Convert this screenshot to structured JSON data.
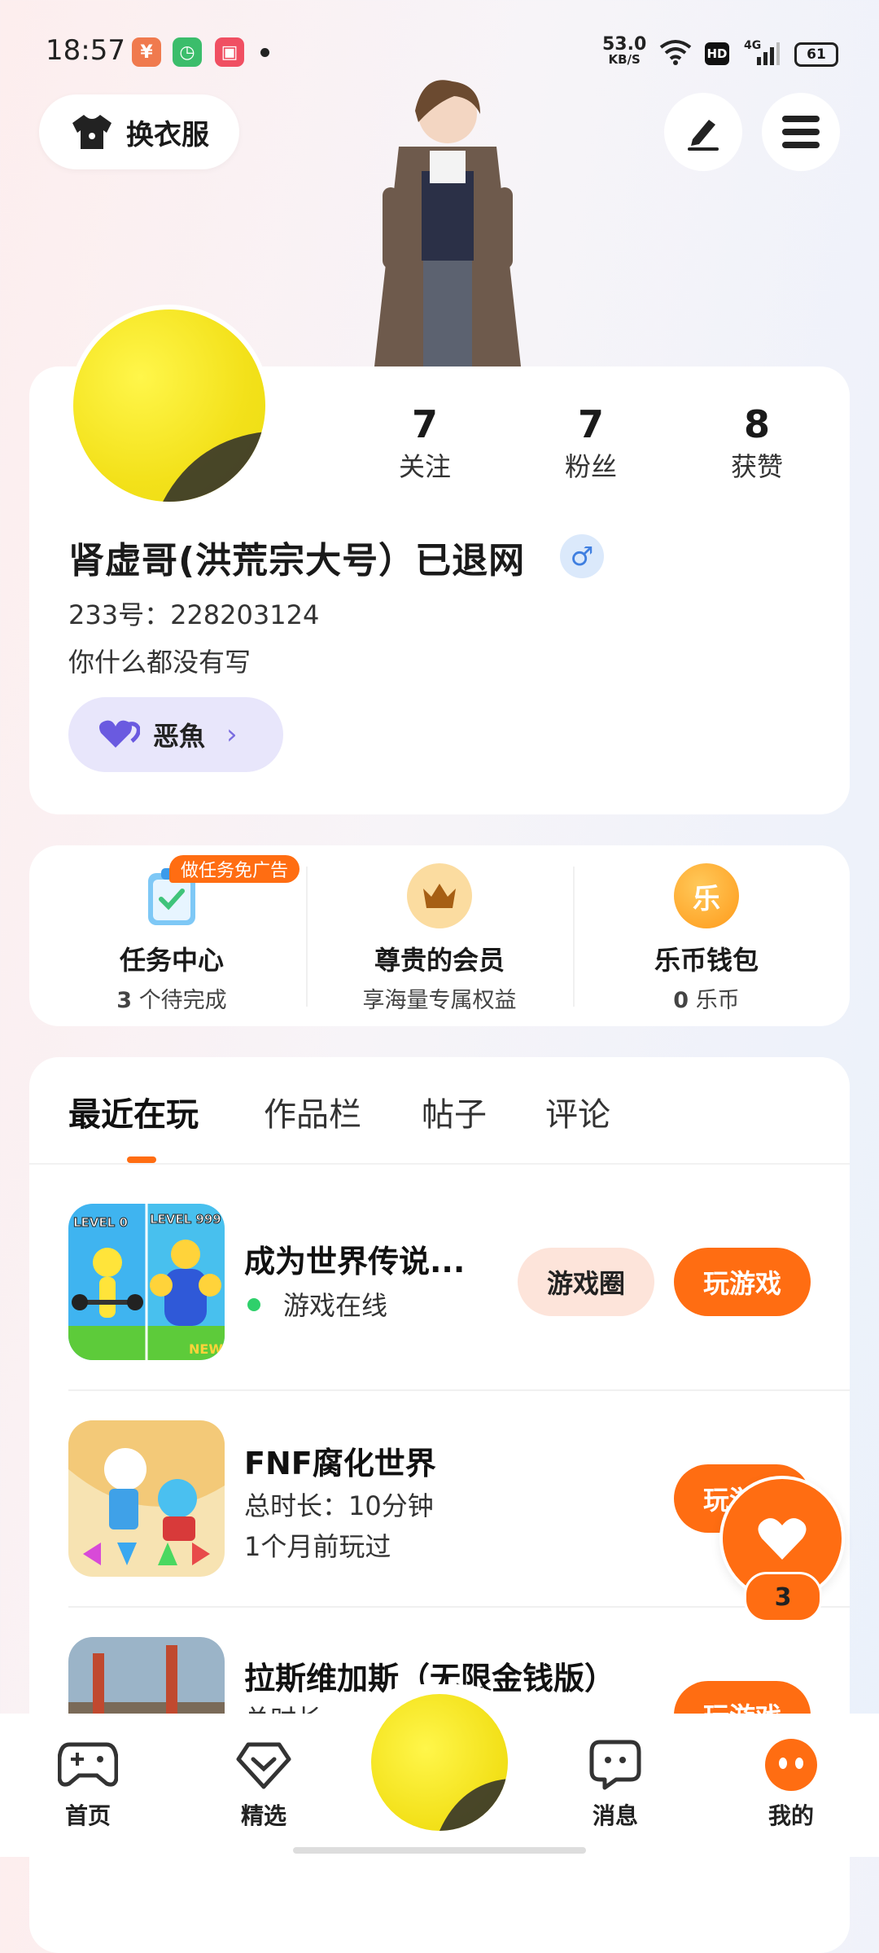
{
  "status_bar": {
    "time": "18:57",
    "net_speed_value": "53.0",
    "net_speed_unit": "KB/S",
    "hd": "HD",
    "network": "4G",
    "battery": "61",
    "app_icons": [
      "wallet-app-icon",
      "clock-app-icon",
      "video-app-icon"
    ]
  },
  "header": {
    "outfit_label": "换衣服",
    "edit_icon": "edit-icon",
    "menu_icon": "menu-icon"
  },
  "profile": {
    "stats": [
      {
        "value": "7",
        "label": "关注"
      },
      {
        "value": "7",
        "label": "粉丝"
      },
      {
        "value": "8",
        "label": "获赞"
      }
    ],
    "nickname": "肾虚哥(洪荒宗大号）已退网",
    "gender_symbol": "♂",
    "uid": "233号：228203124",
    "bio": "你什么都没有写",
    "badge_label": "恶魚"
  },
  "services": [
    {
      "title": "任务中心",
      "count": "3",
      "suffix": "个待完成",
      "tag": "做任务免广告"
    },
    {
      "title": "尊贵的会员",
      "sub": "享海量专属权益"
    },
    {
      "title": "乐币钱包",
      "count": "0",
      "suffix": "乐币",
      "icon_text": "乐"
    }
  ],
  "tabs": [
    "最近在玩",
    "作品栏",
    "帖子",
    "评论"
  ],
  "games": [
    {
      "title": "成为世界传说...",
      "status": "游戏在线",
      "circle_label": "游戏圈",
      "play_label": "玩游戏",
      "thumb_text_left": "LEVEL 0",
      "thumb_text_right": "LEVEL 999",
      "thumb_tag": "NEW"
    },
    {
      "title": "FNF腐化世界",
      "duration": "总时长：10分钟",
      "last_played": "1个月前玩过",
      "play_label": "玩游戏"
    },
    {
      "title": "拉斯维加斯（无限金钱版）",
      "duration": "总时长",
      "play_label": "玩游戏"
    }
  ],
  "like_fab": {
    "count": "3"
  },
  "bottom_nav": [
    {
      "label": "首页",
      "icon": "gamepad-icon"
    },
    {
      "label": "精选",
      "icon": "heart-diamond-icon"
    },
    {
      "label": "消息",
      "icon": "chat-icon"
    },
    {
      "label": "我的",
      "icon": "profile-dots-icon"
    }
  ],
  "colors": {
    "accent": "#ff6d12",
    "accent_soft": "#fde4da",
    "badge_bg": "#e8e6fb",
    "online": "#2fd06b"
  }
}
